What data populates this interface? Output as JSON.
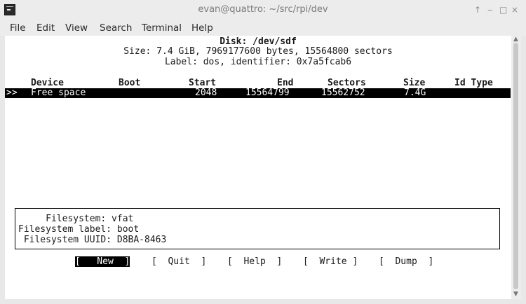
{
  "window": {
    "title": "evan@quattro: ~/src/rpi/dev",
    "controls": {
      "up": "↑",
      "minimize": "‒",
      "maximize": "□",
      "close": "×"
    }
  },
  "menu": [
    "File",
    "Edit",
    "View",
    "Search",
    "Terminal",
    "Help"
  ],
  "disk": {
    "title": "Disk: /dev/sdf",
    "size_line": "Size: 7.4 GiB, 7969177600 bytes, 15564800 sectors",
    "label_line": "Label: dos, identifier: 0x7a5fcab6"
  },
  "table": {
    "headers": {
      "device": "Device",
      "boot": "Boot",
      "start": "Start",
      "end": "End",
      "sectors": "Sectors",
      "size": "Size",
      "idtype": "Id Type"
    },
    "rows": [
      {
        "marker": ">>",
        "device": "Free space",
        "boot": "",
        "start": "2048",
        "end": "15564799",
        "sectors": "15562752",
        "size": "7.4G",
        "idtype": ""
      }
    ]
  },
  "info": {
    "lines": [
      "     Filesystem: vfat",
      "Filesystem label: boot",
      " Filesystem UUID: D8BA-8463"
    ]
  },
  "buttons": [
    {
      "label": "[   New  ]",
      "active": true
    },
    {
      "label": "[  Quit  ]",
      "active": false
    },
    {
      "label": "[  Help  ]",
      "active": false
    },
    {
      "label": "[  Write ]",
      "active": false
    },
    {
      "label": "[  Dump  ]",
      "active": false
    }
  ]
}
